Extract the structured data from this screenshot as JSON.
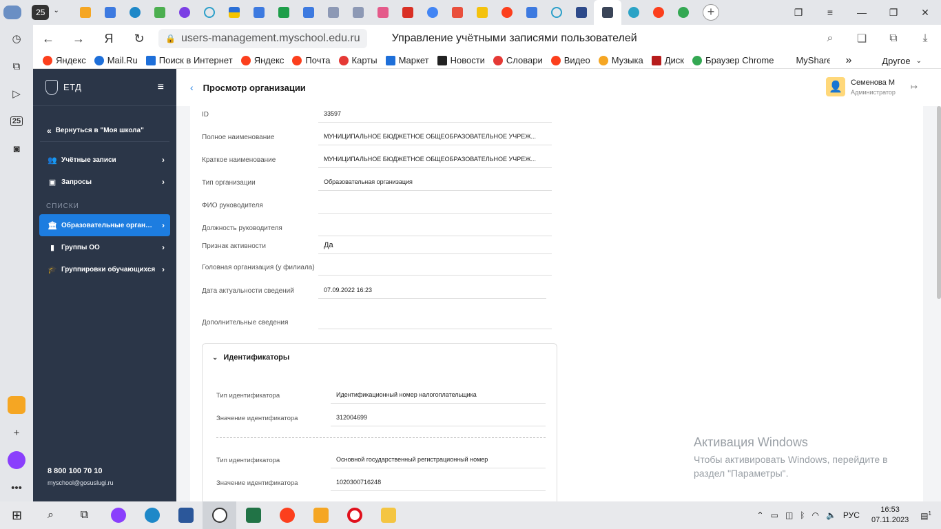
{
  "browser": {
    "tab_count": "25",
    "url": "users-management.myschool.edu.ru",
    "page_title": "Управление учётными записями пользователей",
    "bookmarks": [
      "Яндекс",
      "Mail.Ru",
      "Поиск в Интернет",
      "Яндекс",
      "Почта",
      "Карты",
      "Маркет",
      "Новости",
      "Словари",
      "Видео",
      "Музыка",
      "Диск",
      "Браузер Chrome",
      "MyShare"
    ],
    "bookmarks_more": "Другое",
    "sidebar_badge": "25"
  },
  "sidebar": {
    "logo": "ЕТД",
    "back": "Вернуться в \"Моя школа\"",
    "items": [
      {
        "label": "Учётные записи"
      },
      {
        "label": "Запросы"
      }
    ],
    "section_title": "СПИСКИ",
    "list_items": [
      {
        "label": "Образовательные организа..."
      },
      {
        "label": "Группы ОО"
      },
      {
        "label": "Группировки обучающихся"
      }
    ],
    "phone": "8 800 100 70 10",
    "email": "myschool@gosuslugi.ru"
  },
  "header": {
    "title": "Просмотр организации",
    "user_name": "Семенова М",
    "user_role": "Администратор"
  },
  "fields": [
    {
      "label": "ID",
      "value": "33597"
    },
    {
      "label": "Полное наименование",
      "value": "МУНИЦИПАЛЬНОЕ БЮДЖЕТНОЕ ОБЩЕОБРАЗОВАТЕЛЬНОЕ УЧРЕЖ..."
    },
    {
      "label": "Краткое наименование",
      "value": "МУНИЦИПАЛЬНОЕ БЮДЖЕТНОЕ ОБЩЕОБРАЗОВАТЕЛЬНОЕ УЧРЕЖ..."
    },
    {
      "label": "Тип организации",
      "value": "Образовательная организация"
    },
    {
      "label": "ФИО руководителя",
      "value": ""
    },
    {
      "label": "Должность руководителя",
      "value": ""
    },
    {
      "label": "Признак активности",
      "value": "Да"
    },
    {
      "label": "Головная организация (у филиала)",
      "value": ""
    },
    {
      "label": "Дата актуальности сведений",
      "value": "07.09.2022 16:23"
    },
    {
      "label": "Дополнительные сведения",
      "value": ""
    }
  ],
  "identifiers": {
    "title": "Идентификаторы",
    "rows": [
      {
        "type_label": "Тип идентификатора",
        "type_value": "Идентификационный номер налогоплательщика",
        "value_label": "Значение идентификатора",
        "value": "312004699"
      },
      {
        "type_label": "Тип идентификатора",
        "type_value": "Основной государственный регистрационный номер",
        "value_label": "Значение идентификатора",
        "value": "1020300716248"
      }
    ]
  },
  "watermark": {
    "title": "Активация Windows",
    "text": "Чтобы активировать Windows, перейдите в раздел \"Параметры\"."
  },
  "taskbar": {
    "lang": "РУС",
    "time": "16:53",
    "date": "07.11.2023",
    "notif": "1"
  }
}
